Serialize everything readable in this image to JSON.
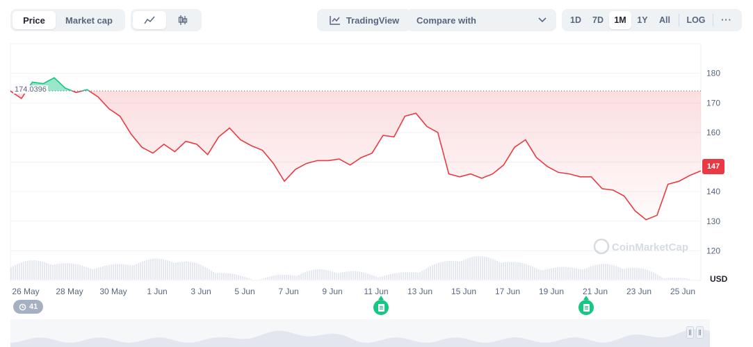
{
  "toolbar": {
    "type_options": [
      "Price",
      "Market cap"
    ],
    "tradingview_label": "TradingView",
    "compare_label": "Compare with",
    "ranges": [
      "1D",
      "7D",
      "1M",
      "1Y",
      "All"
    ],
    "log_label": "LOG",
    "more_label": "···"
  },
  "badges": {
    "history_count": "41",
    "price_tag": "147",
    "open_price": "174.0396",
    "currency": "USD",
    "watermark": "CoinMarketCap"
  },
  "colors": {
    "down": "#ea3943",
    "up": "#16c784",
    "grid": "#eff2f5",
    "volume": "#cfd6e4"
  },
  "chart_data": {
    "type": "line",
    "title": "",
    "xlabel": "",
    "ylabel": "USD",
    "ylim": [
      110,
      190
    ],
    "y_ticks": [
      "120",
      "130",
      "140",
      "150",
      "160",
      "170",
      "180"
    ],
    "x_ticks": [
      "26 May",
      "28 May",
      "30 May",
      "1 Jun",
      "3 Jun",
      "5 Jun",
      "7 Jun",
      "9 Jun",
      "11 Jun",
      "13 Jun",
      "15 Jun",
      "17 Jun",
      "19 Jun",
      "21 Jun",
      "23 Jun",
      "25 Jun"
    ],
    "reference_price": 174.0396,
    "current_price": 147,
    "grid": true,
    "series": [
      {
        "x": [
          "25 May 00:00",
          "25 May 12:00",
          "26 May 00:00",
          "26 May 12:00",
          "27 May 00:00",
          "27 May 12:00",
          "28 May 00:00",
          "28 May 12:00",
          "29 May 00:00",
          "29 May 12:00",
          "30 May 00:00",
          "30 May 12:00",
          "31 May 00:00",
          "31 May 12:00",
          "1 Jun 00:00",
          "1 Jun 12:00",
          "2 Jun 00:00",
          "2 Jun 12:00",
          "3 Jun 00:00",
          "3 Jun 12:00",
          "4 Jun 00:00",
          "4 Jun 12:00",
          "5 Jun 00:00",
          "5 Jun 12:00",
          "6 Jun 00:00",
          "6 Jun 12:00",
          "7 Jun 00:00",
          "7 Jun 12:00",
          "8 Jun 00:00",
          "8 Jun 12:00",
          "9 Jun 00:00",
          "9 Jun 12:00",
          "10 Jun 00:00",
          "10 Jun 12:00",
          "11 Jun 00:00",
          "11 Jun 12:00",
          "12 Jun 00:00",
          "12 Jun 12:00",
          "13 Jun 00:00",
          "13 Jun 12:00",
          "14 Jun 00:00",
          "14 Jun 12:00",
          "15 Jun 00:00",
          "15 Jun 12:00",
          "16 Jun 00:00",
          "16 Jun 12:00",
          "17 Jun 00:00",
          "17 Jun 12:00",
          "18 Jun 00:00",
          "18 Jun 12:00",
          "19 Jun 00:00",
          "19 Jun 12:00",
          "20 Jun 00:00",
          "20 Jun 12:00",
          "21 Jun 00:00",
          "21 Jun 12:00",
          "22 Jun 00:00",
          "22 Jun 12:00",
          "23 Jun 00:00",
          "23 Jun 12:00",
          "24 Jun 00:00",
          "24 Jun 12:00",
          "25 Jun 00:00",
          "25 Jun 12:00"
        ],
        "values": [
          174.0,
          171.5,
          177.0,
          176.5,
          178.5,
          175.0,
          173.5,
          174.5,
          172.0,
          168.0,
          165.5,
          159.5,
          155.0,
          153.0,
          156.0,
          153.5,
          157.0,
          156.0,
          152.5,
          158.5,
          161.5,
          157.5,
          155.5,
          154.0,
          149.5,
          143.5,
          147.5,
          149.5,
          150.5,
          150.5,
          151.0,
          149.0,
          151.5,
          153.0,
          159.0,
          158.5,
          165.5,
          166.5,
          162.0,
          160.0,
          146.0,
          145.0,
          146.0,
          144.5,
          146.0,
          149.0,
          155.0,
          157.5,
          151.5,
          148.5,
          146.5,
          146.0,
          145.0,
          145.0,
          141.0,
          140.5,
          138.5,
          133.5,
          130.5,
          132.0,
          142.5,
          143.5,
          145.5,
          147.0
        ]
      }
    ]
  }
}
